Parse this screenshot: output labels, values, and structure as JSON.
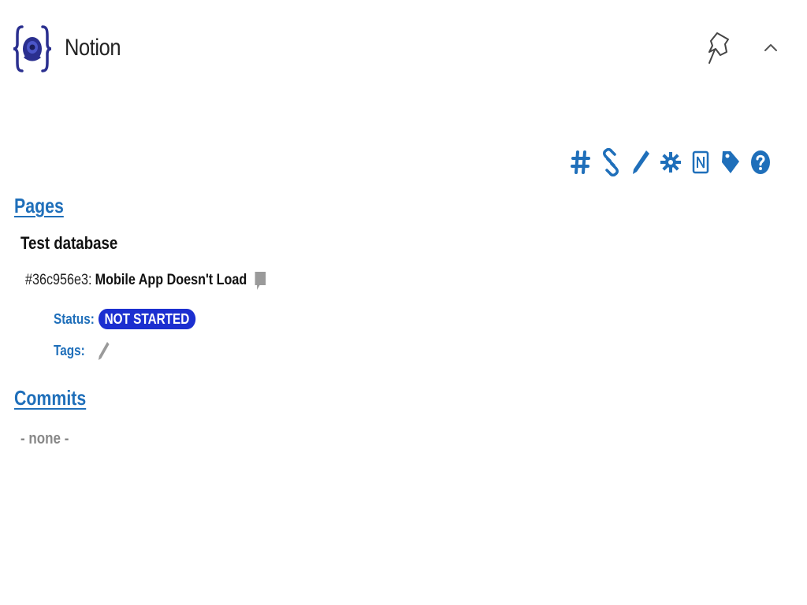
{
  "header": {
    "app_title": "Notion",
    "logo_icon": "curly-braces-eye-logo",
    "pin_icon": "pin-icon",
    "collapse_icon": "chevron-up-icon"
  },
  "toolbar": {
    "items": [
      {
        "icon": "hash-icon"
      },
      {
        "icon": "link-icon"
      },
      {
        "icon": "pencil-icon"
      },
      {
        "icon": "gear-icon"
      },
      {
        "icon": "notion-icon"
      },
      {
        "icon": "tag-icon"
      },
      {
        "icon": "help-icon"
      }
    ]
  },
  "pages": {
    "section_title": "Pages",
    "database_name": "Test database",
    "page": {
      "id": "#36c956e3",
      "separator": ":",
      "title": "Mobile App Doesn't Load",
      "status_label": "Status:",
      "status_value": "NOT STARTED",
      "tags_label": "Tags:"
    }
  },
  "commits": {
    "section_title": "Commits",
    "empty_text": "- none -"
  },
  "colors": {
    "accent": "#1f6fba",
    "status_badge": "#1c2fd0",
    "logo": "#2a2f8f",
    "muted": "#888888"
  }
}
